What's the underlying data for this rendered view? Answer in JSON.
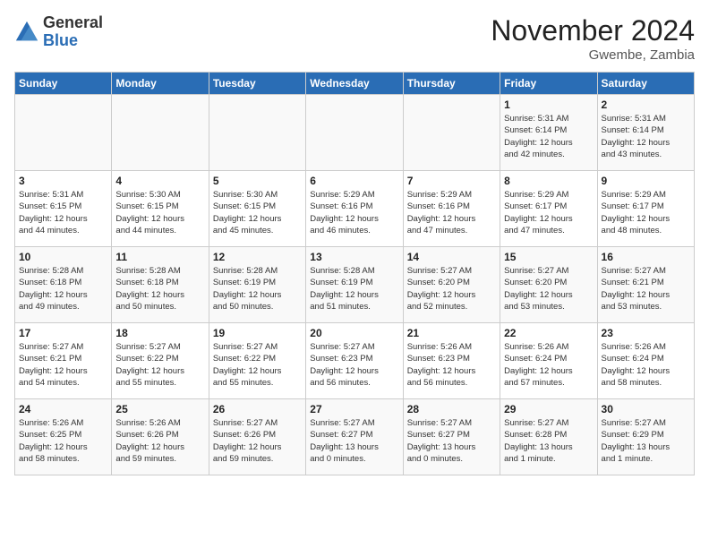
{
  "header": {
    "logo_general": "General",
    "logo_blue": "Blue",
    "title": "November 2024",
    "location": "Gwembe, Zambia"
  },
  "calendar": {
    "days_of_week": [
      "Sunday",
      "Monday",
      "Tuesday",
      "Wednesday",
      "Thursday",
      "Friday",
      "Saturday"
    ],
    "weeks": [
      [
        {
          "day": "",
          "info": ""
        },
        {
          "day": "",
          "info": ""
        },
        {
          "day": "",
          "info": ""
        },
        {
          "day": "",
          "info": ""
        },
        {
          "day": "",
          "info": ""
        },
        {
          "day": "1",
          "info": "Sunrise: 5:31 AM\nSunset: 6:14 PM\nDaylight: 12 hours\nand 42 minutes."
        },
        {
          "day": "2",
          "info": "Sunrise: 5:31 AM\nSunset: 6:14 PM\nDaylight: 12 hours\nand 43 minutes."
        }
      ],
      [
        {
          "day": "3",
          "info": "Sunrise: 5:31 AM\nSunset: 6:15 PM\nDaylight: 12 hours\nand 44 minutes."
        },
        {
          "day": "4",
          "info": "Sunrise: 5:30 AM\nSunset: 6:15 PM\nDaylight: 12 hours\nand 44 minutes."
        },
        {
          "day": "5",
          "info": "Sunrise: 5:30 AM\nSunset: 6:15 PM\nDaylight: 12 hours\nand 45 minutes."
        },
        {
          "day": "6",
          "info": "Sunrise: 5:29 AM\nSunset: 6:16 PM\nDaylight: 12 hours\nand 46 minutes."
        },
        {
          "day": "7",
          "info": "Sunrise: 5:29 AM\nSunset: 6:16 PM\nDaylight: 12 hours\nand 47 minutes."
        },
        {
          "day": "8",
          "info": "Sunrise: 5:29 AM\nSunset: 6:17 PM\nDaylight: 12 hours\nand 47 minutes."
        },
        {
          "day": "9",
          "info": "Sunrise: 5:29 AM\nSunset: 6:17 PM\nDaylight: 12 hours\nand 48 minutes."
        }
      ],
      [
        {
          "day": "10",
          "info": "Sunrise: 5:28 AM\nSunset: 6:18 PM\nDaylight: 12 hours\nand 49 minutes."
        },
        {
          "day": "11",
          "info": "Sunrise: 5:28 AM\nSunset: 6:18 PM\nDaylight: 12 hours\nand 50 minutes."
        },
        {
          "day": "12",
          "info": "Sunrise: 5:28 AM\nSunset: 6:19 PM\nDaylight: 12 hours\nand 50 minutes."
        },
        {
          "day": "13",
          "info": "Sunrise: 5:28 AM\nSunset: 6:19 PM\nDaylight: 12 hours\nand 51 minutes."
        },
        {
          "day": "14",
          "info": "Sunrise: 5:27 AM\nSunset: 6:20 PM\nDaylight: 12 hours\nand 52 minutes."
        },
        {
          "day": "15",
          "info": "Sunrise: 5:27 AM\nSunset: 6:20 PM\nDaylight: 12 hours\nand 53 minutes."
        },
        {
          "day": "16",
          "info": "Sunrise: 5:27 AM\nSunset: 6:21 PM\nDaylight: 12 hours\nand 53 minutes."
        }
      ],
      [
        {
          "day": "17",
          "info": "Sunrise: 5:27 AM\nSunset: 6:21 PM\nDaylight: 12 hours\nand 54 minutes."
        },
        {
          "day": "18",
          "info": "Sunrise: 5:27 AM\nSunset: 6:22 PM\nDaylight: 12 hours\nand 55 minutes."
        },
        {
          "day": "19",
          "info": "Sunrise: 5:27 AM\nSunset: 6:22 PM\nDaylight: 12 hours\nand 55 minutes."
        },
        {
          "day": "20",
          "info": "Sunrise: 5:27 AM\nSunset: 6:23 PM\nDaylight: 12 hours\nand 56 minutes."
        },
        {
          "day": "21",
          "info": "Sunrise: 5:26 AM\nSunset: 6:23 PM\nDaylight: 12 hours\nand 56 minutes."
        },
        {
          "day": "22",
          "info": "Sunrise: 5:26 AM\nSunset: 6:24 PM\nDaylight: 12 hours\nand 57 minutes."
        },
        {
          "day": "23",
          "info": "Sunrise: 5:26 AM\nSunset: 6:24 PM\nDaylight: 12 hours\nand 58 minutes."
        }
      ],
      [
        {
          "day": "24",
          "info": "Sunrise: 5:26 AM\nSunset: 6:25 PM\nDaylight: 12 hours\nand 58 minutes."
        },
        {
          "day": "25",
          "info": "Sunrise: 5:26 AM\nSunset: 6:26 PM\nDaylight: 12 hours\nand 59 minutes."
        },
        {
          "day": "26",
          "info": "Sunrise: 5:27 AM\nSunset: 6:26 PM\nDaylight: 12 hours\nand 59 minutes."
        },
        {
          "day": "27",
          "info": "Sunrise: 5:27 AM\nSunset: 6:27 PM\nDaylight: 13 hours\nand 0 minutes."
        },
        {
          "day": "28",
          "info": "Sunrise: 5:27 AM\nSunset: 6:27 PM\nDaylight: 13 hours\nand 0 minutes."
        },
        {
          "day": "29",
          "info": "Sunrise: 5:27 AM\nSunset: 6:28 PM\nDaylight: 13 hours\nand 1 minute."
        },
        {
          "day": "30",
          "info": "Sunrise: 5:27 AM\nSunset: 6:29 PM\nDaylight: 13 hours\nand 1 minute."
        }
      ]
    ]
  }
}
